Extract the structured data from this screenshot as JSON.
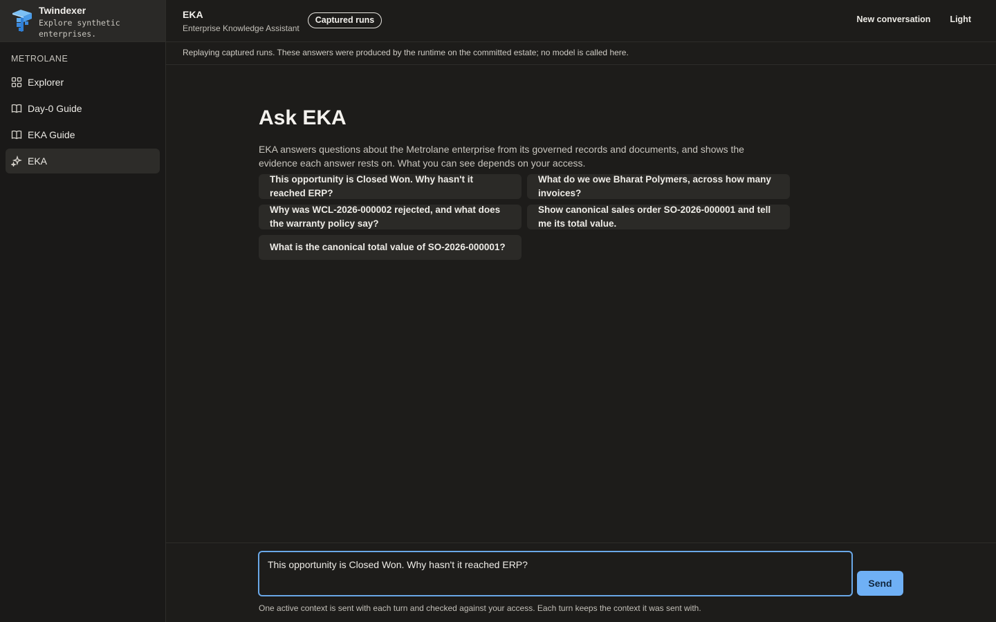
{
  "brand": {
    "name": "Twindexer",
    "tagline": "Explore synthetic enterprises."
  },
  "sidebar": {
    "workspace": "METROLANE",
    "items": [
      {
        "label": "Explorer",
        "icon": "grid-icon"
      },
      {
        "label": "Day-0 Guide",
        "icon": "book-icon"
      },
      {
        "label": "EKA Guide",
        "icon": "book-icon"
      },
      {
        "label": "EKA",
        "icon": "sparkles-icon",
        "active": true
      }
    ]
  },
  "topbar": {
    "title": "EKA",
    "subtitle": "Enterprise Knowledge Assistant",
    "badge": "Captured runs",
    "new_conversation": "New conversation",
    "theme": "Light"
  },
  "notice": "Replaying captured runs. These answers were produced by the runtime on the committed estate; no model is called here.",
  "main": {
    "heading": "Ask EKA",
    "intro": "EKA answers questions about the Metrolane enterprise from its governed records and documents, and shows the evidence each answer rests on. What you can see depends on your access.",
    "suggestions": [
      "This opportunity is Closed Won. Why hasn't it reached ERP?",
      "What do we owe Bharat Polymers, across how many invoices?",
      "Why was WCL-2026-000002 rejected, and what does the warranty policy say?",
      "Show canonical sales order SO-2026-000001 and tell me its total value.",
      "What is the canonical total value of SO-2026-000001?"
    ]
  },
  "composer": {
    "value": "This opportunity is Closed Won. Why hasn't it reached ERP?",
    "send_label": "Send",
    "hint": "One active context is sent with each turn and checked against your access. Each turn keeps the context it was sent with."
  },
  "colors": {
    "background": "#1d1c1a",
    "sidebar": "#1a1918",
    "accent": "#6fb0f5",
    "focus_ring": "#6aa8e8"
  }
}
